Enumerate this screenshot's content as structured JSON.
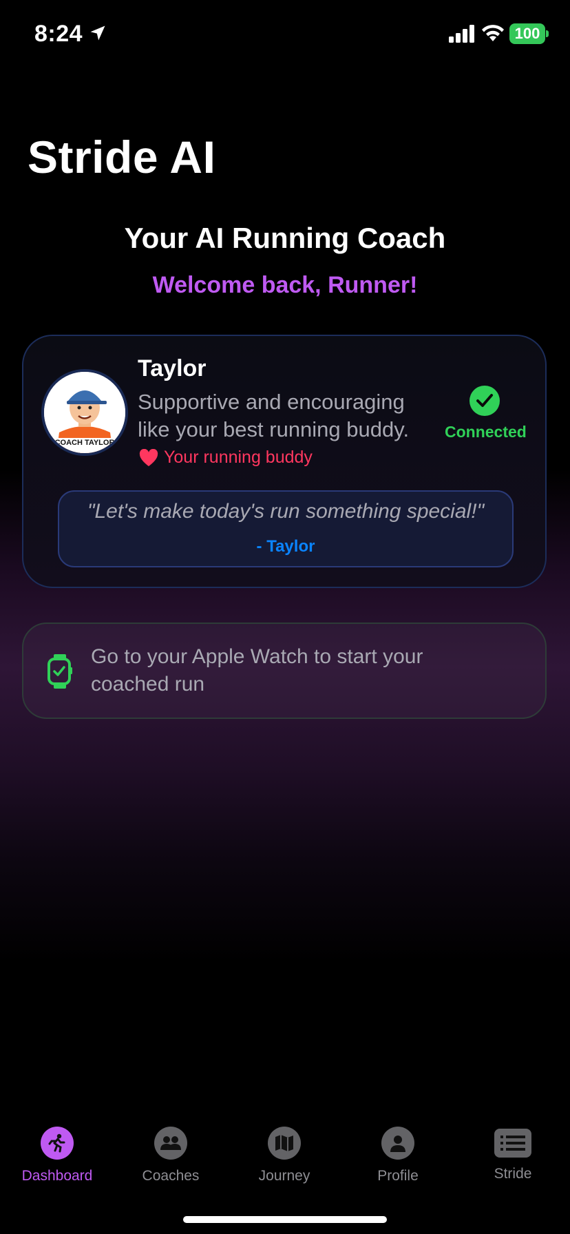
{
  "status_bar": {
    "time": "8:24",
    "battery": "100"
  },
  "app": {
    "title": "Stride AI",
    "subtitle": "Your AI Running Coach",
    "welcome": "Welcome back, Runner!"
  },
  "coach": {
    "name": "Taylor",
    "description": "Supportive and encouraging like your best running buddy.",
    "tagline": "Your running buddy",
    "status": "Connected",
    "avatar_caption": "COACH TAYLOR",
    "quote": "\"Let's make today's run something special!\"",
    "quote_author": "- Taylor"
  },
  "watch_prompt": {
    "text": "Go to your Apple Watch to start your coached run"
  },
  "tabs": [
    {
      "label": "Dashboard",
      "icon": "runner-icon",
      "active": true
    },
    {
      "label": "Coaches",
      "icon": "people-icon",
      "active": false
    },
    {
      "label": "Journey",
      "icon": "map-icon",
      "active": false
    },
    {
      "label": "Profile",
      "icon": "person-icon",
      "active": false
    },
    {
      "label": "Stride",
      "icon": "list-icon",
      "active": false
    }
  ],
  "colors": {
    "accent": "#bf5af2",
    "success": "#30d158",
    "heart": "#ff375f",
    "link": "#0a84ff"
  }
}
